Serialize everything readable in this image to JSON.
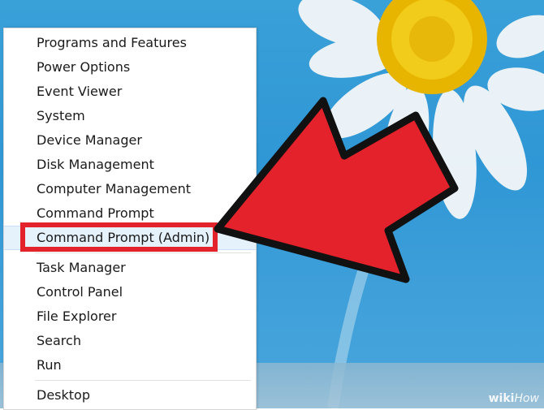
{
  "menu": {
    "items": [
      "Programs and Features",
      "Power Options",
      "Event Viewer",
      "System",
      "Device Manager",
      "Disk Management",
      "Computer Management",
      "Command Prompt",
      "Command Prompt (Admin)",
      "Task Manager",
      "Control Panel",
      "File Explorer",
      "Search",
      "Run",
      "Desktop"
    ]
  },
  "watermark": {
    "wiki": "wiki",
    "how": "How"
  },
  "colors": {
    "highlight": "#e3222b",
    "arrow": "#e3222b",
    "hover": "#e5f1fb"
  }
}
